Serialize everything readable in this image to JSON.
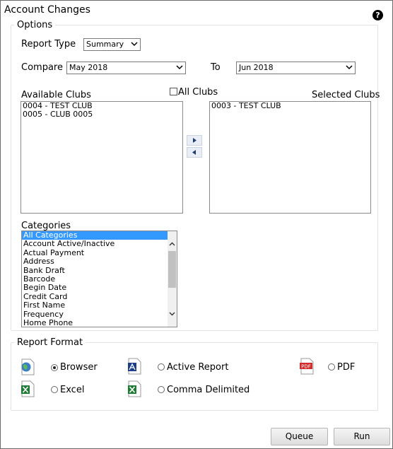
{
  "title": "Account Changes",
  "options": {
    "legend": "Options",
    "report_type_label": "Report Type",
    "report_type_value": "Summary",
    "compare_label": "Compare",
    "compare_value": "May 2018",
    "to_label": "To",
    "to_value": "Jun 2018",
    "available_clubs_label": "Available Clubs",
    "all_clubs_label": "All Clubs",
    "selected_clubs_label": "Selected Clubs",
    "available_clubs": [
      "0004 - TEST CLUB",
      "0005 - CLUB 0005"
    ],
    "selected_clubs": [
      "0003 - TEST CLUB"
    ],
    "categories_label": "Categories",
    "categories": [
      "All Categories",
      "Account Active/Inactive",
      "Actual Payment",
      "Address",
      "Bank Draft",
      "Barcode",
      "Begin Date",
      "Credit Card",
      "First Name",
      "Frequency",
      "Home Phone"
    ]
  },
  "report_format": {
    "legend": "Report Format",
    "browser_label": "Browser",
    "active_report_label": "Active Report",
    "pdf_label": "PDF",
    "pdf_icon_text": "PDF",
    "excel_label": "Excel",
    "comma_label": "Comma Delimited",
    "selected": "Browser"
  },
  "buttons": {
    "queue": "Queue",
    "run": "Run"
  },
  "help_icon_text": "?"
}
